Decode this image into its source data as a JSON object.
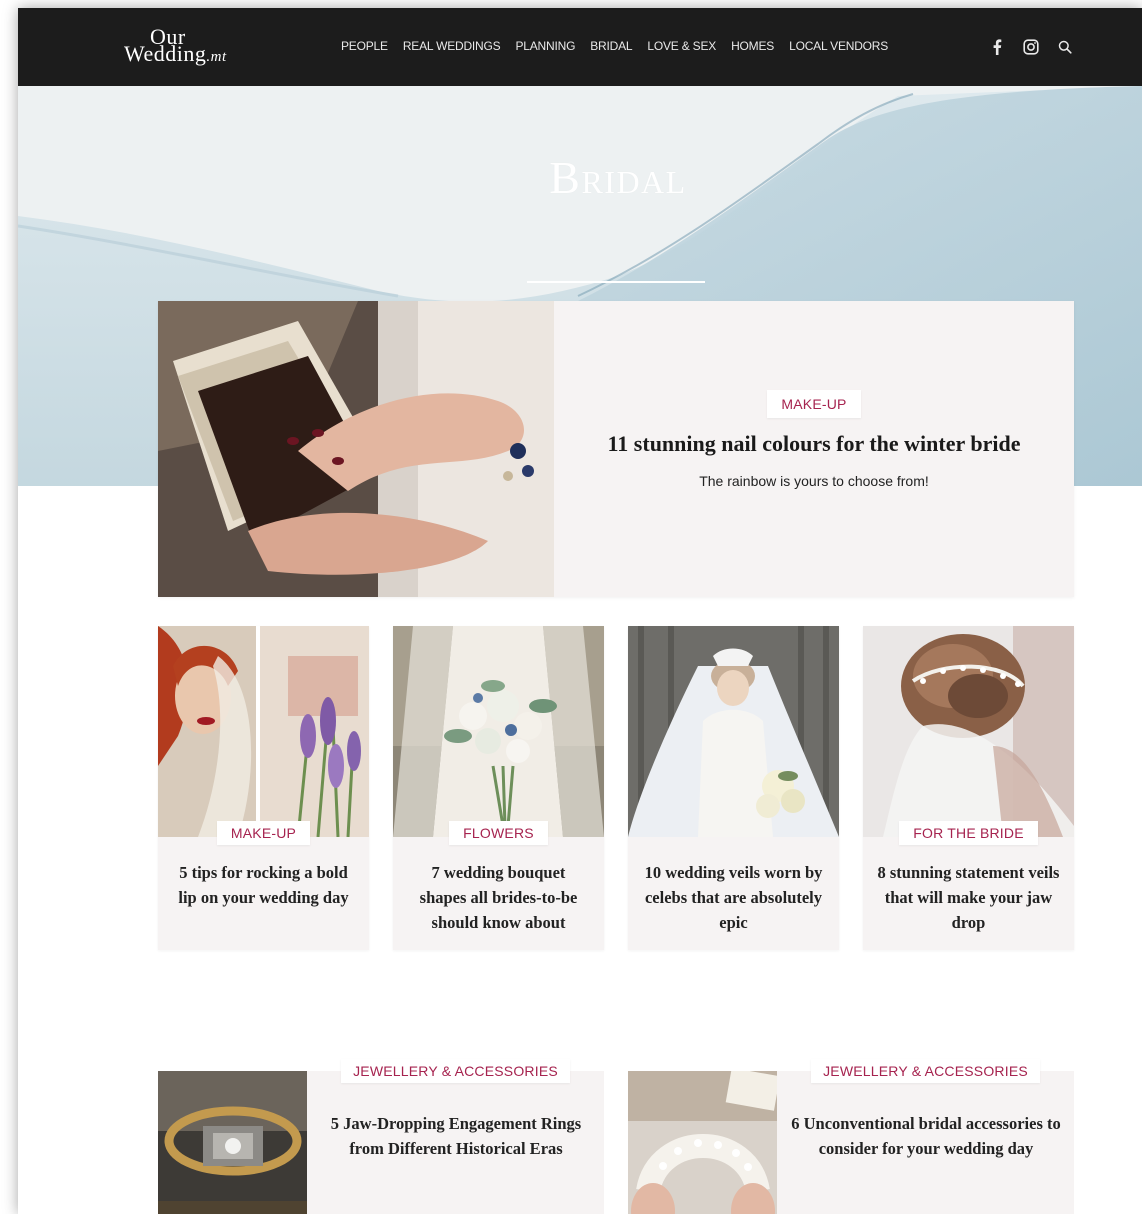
{
  "header": {
    "logo_line1": "Our",
    "logo_line2": "Wedding",
    "logo_suffix": ".mt",
    "nav": [
      "PEOPLE",
      "REAL WEDDINGS",
      "PLANNING",
      "BRIDAL",
      "LOVE & SEX",
      "HOMES",
      "LOCAL VENDORS"
    ],
    "social_icons": [
      "facebook-icon",
      "instagram-icon",
      "search-icon"
    ]
  },
  "hero": {
    "title": "Bridal"
  },
  "featured": {
    "category": "MAKE-UP",
    "title": "11 stunning nail colours for the winter bride",
    "subtitle": "The rainbow is yours to choose from!"
  },
  "cards": [
    {
      "category": "MAKE-UP",
      "title": "5 tips for rocking a bold lip on your wedding day"
    },
    {
      "category": "FLOWERS",
      "title": "7 wedding bouquet shapes all brides-to-be should know about"
    },
    {
      "category": "",
      "title": "10 wedding veils worn by celebs that are absolutely epic"
    },
    {
      "category": "FOR THE BRIDE",
      "title": "8 stunning statement veils that will make your jaw drop"
    }
  ],
  "bottom_cards": [
    {
      "category": "JEWELLERY & ACCESSORIES",
      "title": "5 Jaw-Dropping Engagement Rings from Different Historical Eras"
    },
    {
      "category": "JEWELLERY & ACCESSORIES",
      "title": "6 Unconventional bridal accessories to consider for your wedding day"
    }
  ],
  "colors": {
    "header_bg": "#1c1c1c",
    "accent": "#a6234f",
    "card_bg": "#f6f3f3",
    "hero_watercolor": "#bcd3dd"
  }
}
